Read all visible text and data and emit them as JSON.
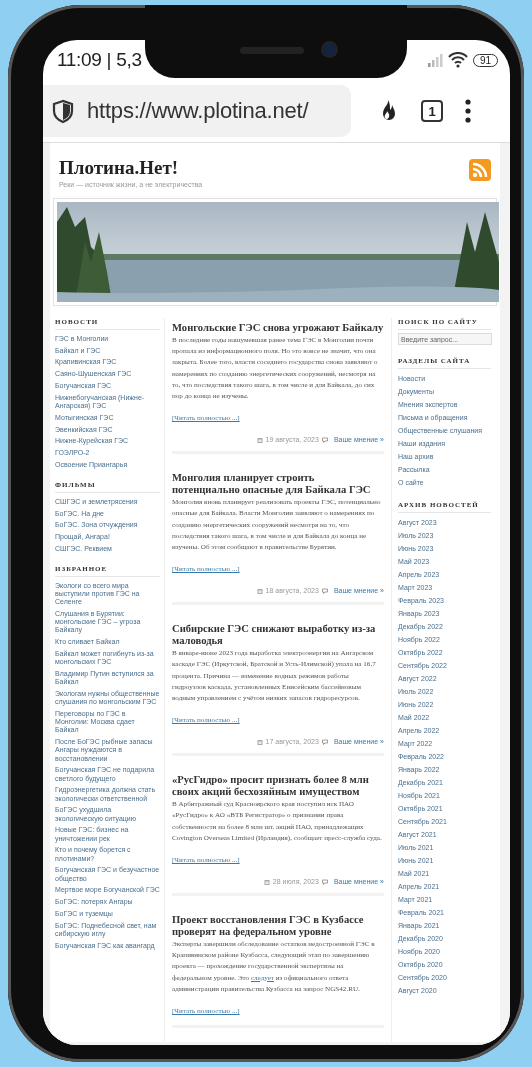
{
  "status_bar": {
    "time": "11:09 | 5,3",
    "battery": "91"
  },
  "browser": {
    "url": "https://www.plotina.net/",
    "tab_count": "1"
  },
  "site": {
    "title": "Плотина.Нет!",
    "tagline": "Реки — источник жизни, а не электричества"
  },
  "left_sidebar": [
    {
      "heading": "НОВОСТИ",
      "links": [
        "ГЭС в Монголии",
        "Байкал и ГЭС",
        "Крапивинская ГЭС",
        "Саяно-Шушенская ГЭС",
        "Богучанская ГЭС",
        "Нижнебогучанская (Нижне-Ангарская) ГЭС",
        "Мотыгинская ГЭС",
        "Эвенкийская ГЭС",
        "Нижне-Курейская ГЭС",
        "ГОЭЛРО-2",
        "Освоение Приангарья"
      ]
    },
    {
      "heading": "ФИЛЬМЫ",
      "links": [
        "СШГЭС и землетрясения",
        "БоГЭС. На дне",
        "БоГЭС. Зона отчуждения",
        "Прощай, Ангара!",
        "СШГЭС. Реквием"
      ]
    },
    {
      "heading": "ИЗБРАННОЕ",
      "links": [
        "Экологи со всего мира выступили против ГЭС на Селенге",
        "Слушания в Бурятии: монгольские ГЭС – угроза Байкалу",
        "Кто сливает Байкал",
        "Байкал может погибнуть из-за монгольских ГЭС",
        "Владимир Путин вступился за Байкал",
        "Экологам нужны общественные слушания по монгольским ГЭС",
        "Переговоры по ГЭС в Монголии: Москва сдает Байкал",
        "После БоГЭС рыбные запасы Ангары нуждаются в восстановлении",
        "Богучанская ГЭС не подарила светлого будущего",
        "Гидроэнергетика должна стать экологически ответственной",
        "БоГЭС ухудшила экологическую ситуацию",
        "Новые ГЭС: бизнес на уничтожении рек",
        "Кто и почему борется с плотинами?",
        "Богучанская ГЭС и безучастное общество",
        "Мертвое море Богучанской ГЭС",
        "БоГЭС: потерях Ангары",
        "БоГЭС и туземцы",
        "БоГЭС: Поднебесной свет, нам сибирскую иглу",
        "Богучанская ГЭС как авангард"
      ]
    }
  ],
  "articles": [
    {
      "title": "Монгольские ГЭС снова угрожают Байкалу",
      "excerpt": [
        {
          "kind": "text",
          "text": "В последние годы нашумевшая ранее тема ГЭС в Монголии почти пропала из информационного поля. Но это вовсе не значит, что она закрыта. Более того, власти соседнего государства снова заявляют о намерениях по созданию энергетических сооружений, несмотря на то, что последствия такого шага, в том числе и для Байкала, до сих пор до конца не изучены."
        }
      ],
      "read_more": "[Читать полностью ...]",
      "date": "19 августа, 2023",
      "comments": "Ваше мнение »"
    },
    {
      "title": "Монголия планирует строить потенциально опасные для Байкала ГЭС",
      "excerpt": [
        {
          "kind": "text",
          "text": "Монголия вновь планирует реализовать проекты ГЭС, потенциально опасные для Байкала. Власти Монголии заявляют о намерениях по созданию энергетических сооружений несмотря на то, что последствия такого шага, в том числе и для Байкала до конца не изучены. Об этом сообщают в правительстве Бурятии."
        }
      ],
      "read_more": "[Читать полностью ...]",
      "date": "18 августа, 2023",
      "comments": "Ваше мнение »"
    },
    {
      "title": "Сибирские ГЭС снижают выработку из-за маловодья",
      "excerpt": [
        {
          "kind": "text",
          "text": "В январе-июне 2023 года выработка электроэнергии на Ангарском каскаде ГЭС (Иркутской, Братской и Усть-Илимской) упала на 16,7 процента. Причина — изменение водных режимов работы гидроузлов каскада, установленных Енисейским бассейновым водным управлением с учётом низких запасов гидроресурсов."
        }
      ],
      "read_more": "[Читать полностью ...]",
      "date": "17 августа, 2023",
      "comments": "Ваше мнение »"
    },
    {
      "title": "«РусГидро» просит признать более 8 млн своих акций бесхозяйным имуществом",
      "excerpt": [
        {
          "kind": "text",
          "text": "В Арбитражный суд Красноярского края поступил иск ПАО «РусГидро» к АО «ВТБ Регистратор» о признании права собственности на более 8 млн шт. акций ПАО, принадлежащих Covington Overseas Limited (Ирландия), сообщает пресс-служба суда."
        }
      ],
      "read_more": "[Читать полностью ...]",
      "date": "28 июля, 2023",
      "comments": "Ваше мнение »"
    },
    {
      "title": "Проект восстановления ГЭС в Кузбассе проверят на федеральном уровне",
      "excerpt": [
        {
          "kind": "text",
          "text": "Эксперты завершили обследование остатков недостроенной ГЭС в Крапивинском районе Кузбасса, следующий этап по завершению проекта — прохождение государственной экспертизы на федеральном уровне. Это "
        },
        {
          "kind": "link",
          "text": "следует"
        },
        {
          "kind": "text",
          "text": " из официального ответа администрации правительства Кузбасса на запрос NGS42.RU."
        }
      ],
      "read_more": "[Читать полностью ...]"
    }
  ],
  "right_sidebar": {
    "search": {
      "heading": "ПОИСК ПО САЙТУ",
      "placeholder": "Введите запрос..."
    },
    "sections": {
      "heading": "РАЗДЕЛЫ САЙТА",
      "links": [
        "Новости",
        "Документы",
        "Мнения экспертов",
        "Письма и обращения",
        "Общественные слушания",
        "Наши издания",
        "Наш архив",
        "Рассылка",
        "О сайте"
      ]
    },
    "archive": {
      "heading": "АРХИВ НОВОСТЕЙ",
      "links": [
        "Август 2023",
        "Июль 2023",
        "Июнь 2023",
        "Май 2023",
        "Апрель 2023",
        "Март 2023",
        "Февраль 2023",
        "Январь 2023",
        "Декабрь 2022",
        "Ноябрь 2022",
        "Октябрь 2022",
        "Сентябрь 2022",
        "Август 2022",
        "Июль 2022",
        "Июнь 2022",
        "Май 2022",
        "Апрель 2022",
        "Март 2022",
        "Февраль 2022",
        "Январь 2022",
        "Декабрь 2021",
        "Ноябрь 2021",
        "Октябрь 2021",
        "Сентябрь 2021",
        "Август 2021",
        "Июль 2021",
        "Июнь 2021",
        "Май 2021",
        "Апрель 2021",
        "Март 2021",
        "Февраль 2021",
        "Январь 2021",
        "Декабрь 2020",
        "Ноябрь 2020",
        "Октябрь 2020",
        "Сентябрь 2020",
        "Август 2020"
      ]
    }
  }
}
